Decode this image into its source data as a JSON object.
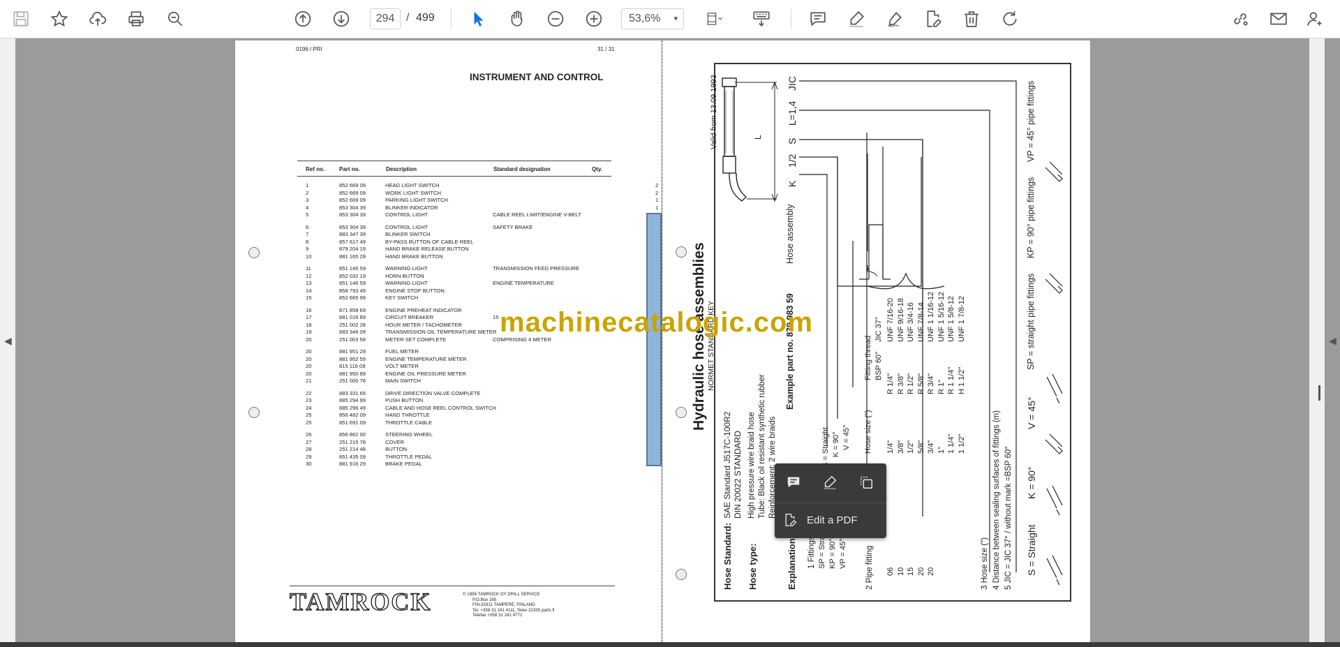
{
  "toolbar": {
    "page_current": "294",
    "page_separator": "/",
    "page_total": "499",
    "zoom_level": "53,6%",
    "zoom_caret": "▾",
    "accent_color": "#1473e6"
  },
  "left_page": {
    "header_left": "0196 / PRI",
    "header_right": "31 / 31",
    "title": "INSTRUMENT AND CONTROL",
    "columns": [
      "Ref no.",
      "Part no.",
      "Description",
      "Standard designation",
      "Qty."
    ],
    "rows": [
      [
        "1",
        "852 669 09",
        "HEAD LIGHT SWITCH",
        "",
        "2"
      ],
      [
        "2",
        "852 669 09",
        "WORK LIGHT SWITCH",
        "",
        "2"
      ],
      [
        "3",
        "852 669 09",
        "PARKING LIGHT SWITCH",
        "",
        "1"
      ],
      [
        "4",
        "853 304 39",
        "BLINKER INDICATOR",
        "",
        "1"
      ],
      [
        "5",
        "853 304 39",
        "CONTROL LIGHT",
        "CABLE REEL LIMIT/ENGINE V-BELT",
        "1"
      ],
      [
        "6",
        "853 304 39",
        "CONTROL LIGHT",
        "SAFETY BRAKE",
        "1"
      ],
      [
        "7",
        "883 347 39",
        "BLINKER SWITCH",
        "",
        "1"
      ],
      [
        "8",
        "857 617 49",
        "BY-PASS BUTTON OF CABLE REEL",
        "",
        "1"
      ],
      [
        "9",
        "879 204 19",
        "HAND BRAKE RELEASE BUTTON",
        "",
        "1"
      ],
      [
        "10",
        "881 165 29",
        "HAND BRAKE BUTTON",
        "",
        "1"
      ],
      [
        "11",
        "851 146 59",
        "WARNING LIGHT",
        "TRANSMISSION FEED PRESSURE",
        "1"
      ],
      [
        "12",
        "852 032 19",
        "HORN BUTTON",
        "",
        "1"
      ],
      [
        "13",
        "851 146 59",
        "WARNING LIGHT",
        "ENGINE TEMPERATURE",
        "1"
      ],
      [
        "14",
        "858 793 49",
        "ENGINE STOP BUTTON",
        "",
        "1"
      ],
      [
        "15",
        "852 665 99",
        "KEY SWITCH",
        "",
        "1"
      ],
      [
        "16",
        "871 858 69",
        "ENGINE PREHEAT INDICATOR",
        "",
        "1"
      ],
      [
        "17",
        "881 016 89",
        "CIRCUIT BREAKER",
        "15",
        "1"
      ],
      [
        "18",
        "251 002 28",
        "HOUR METER / TACHOMETER",
        "",
        "1"
      ],
      [
        "19",
        "883 346 09",
        "TRANSMISSION OIL TEMPERATURE METER",
        "",
        "1"
      ],
      [
        "20",
        "251 003 58",
        "METER SET COMPLETE",
        "COMPRISING 4 METER",
        "1"
      ],
      [
        "20",
        "881 951 29",
        "FUEL METER",
        "",
        "1"
      ],
      [
        "20",
        "881 952 59",
        "ENGINE TEMPERATURE METER",
        "",
        "1"
      ],
      [
        "20",
        "815 116 09",
        "VOLT METER",
        "",
        "1"
      ],
      [
        "20",
        "881 950 89",
        "ENGINE OIL PRESSURE METER",
        "",
        "1"
      ],
      [
        "21",
        "251 000 78",
        "MAIN SWITCH",
        "",
        "1"
      ],
      [
        "22",
        "883 331 69",
        "DRIVE DIRECTION VALVE COMPLETE",
        "",
        "1"
      ],
      [
        "23",
        "885 294 99",
        "PUSH BUTTON",
        "",
        "6"
      ],
      [
        "24",
        "885 296 49",
        "CABLE AND HOSE REEL CONTROL SWITCH",
        "",
        "1"
      ],
      [
        "25",
        "856 482 09",
        "HAND THROTTLE",
        "",
        "1"
      ],
      [
        "25",
        "851 691 09",
        "THROTTLE CABLE",
        "",
        "1"
      ],
      [
        "26",
        "856 862 00",
        "STEERING WHEEL",
        "",
        "1"
      ],
      [
        "27",
        "251 215 78",
        "COVER",
        "",
        "1"
      ],
      [
        "28",
        "251 214 48",
        "BUTTON",
        "",
        "1"
      ],
      [
        "29",
        "851 435 09",
        "THROTTLE PEDAL",
        "",
        "1"
      ],
      [
        "30",
        "881 916 29",
        "BRAKE PEDAL",
        "",
        "1"
      ]
    ],
    "logo_text": "TAMROCK",
    "footer_lines": [
      "© 1996 TAMROCK OY DRILL SERVICE",
      "P.O.Box 165",
      "FIN-33311 TAMPERE, FINLAND",
      "Tel. +358 31 241 4111, Telex 22335 parts fi",
      "Telefax +358 31 241 4771"
    ]
  },
  "right_page": {
    "valid_from": "Valid from 13.09.1993",
    "title": "Hydraulic hose assemblies",
    "subtitle": "NORMET STANDARD KEY",
    "hose_standard_label": "Hose Standard:",
    "hose_standard_value_1": "SAE Standard J517C-100R2",
    "hose_standard_value_2": "DIN 20022 STANDARD",
    "hose_type_label": "Hose type:",
    "hose_type_lines": [
      "High pressure wire braid hose",
      "Tube: Black oil resistant synthetic rubber",
      "Reinforcement: 2 wire braids"
    ],
    "explanation_label": "Explanation of spare part",
    "example": "Example part no. 879 983 59",
    "hose_assembly": "Hose assembly",
    "code_letters": [
      "K",
      "1/2",
      "S",
      "L=1,4",
      "JIC"
    ],
    "fittings_label": "1  Fittings",
    "fittings_list": [
      "SP = Straight",
      "KP = 90°",
      "VP = 45°"
    ],
    "fitting_codes": [
      "S = Straight",
      "K = 90°",
      "V = 45°"
    ],
    "pipe_label": "2  Pipe fitting",
    "hose_size_header": "Hose size (\")",
    "thread_header": "Fitting thread",
    "bsp": "BSP 60°",
    "jic": "JIC 37°",
    "size_rows": [
      [
        "06",
        "1/4\"",
        "R 1/4\"",
        "UNF 7/16-20"
      ],
      [
        "10",
        "3/8\"",
        "R 3/8\"",
        "UNF 9/16-18"
      ],
      [
        "15",
        "1/2\"",
        "R 1/2\"",
        "UNF 3/4-16"
      ],
      [
        "20",
        "5/8\"",
        "R 5/8\"",
        "UNF 7/8-14"
      ],
      [
        "20",
        "3/4\"",
        "R 3/4\"",
        "UNF 1 1/16-12"
      ],
      [
        "",
        "1\"",
        "R 1\"",
        "UNF 1 5/16-12"
      ],
      [
        "",
        "1 1/4\"",
        "R 1 1/4\"",
        "UNF 1 5/8-12"
      ],
      [
        "",
        "1 1/2\"",
        "H 1 1/2\"",
        "UNF 1 7/8-12"
      ]
    ],
    "item3": "3   Hose size (\")",
    "item4": "4   Distance between sealing surfaces of fittings (m)",
    "item5": "5   JIC = JIC 37° / without mark =BSP 60°",
    "bottom_labels": [
      "S = Straight",
      "K = 90°",
      "V = 45°",
      "SP = straight pipe fittings",
      "KP = 90° pipe fittings",
      "VP = 45° pipe fittings"
    ],
    "length_mark": "L"
  },
  "watermark": "machinecatalogic.com",
  "popup": {
    "edit_label": "Edit a PDF"
  }
}
